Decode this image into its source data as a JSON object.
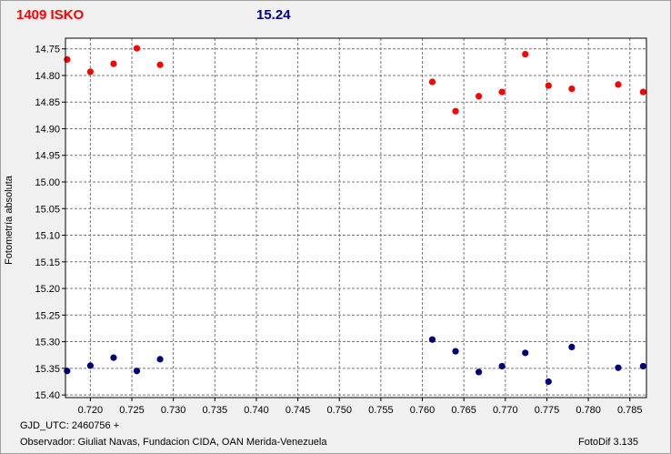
{
  "header": {
    "object_label": "1409 ISKO",
    "magnitude_label": "15.24"
  },
  "footer": {
    "gjd": "GJD_UTC: 2460756 +",
    "observer": "Observador: Giuliat Navas, Fundacion CIDA, OAN  Merida-Venezuela",
    "version": "FotoDif 3.135"
  },
  "colors": {
    "series_target": "#ff0000",
    "series_comparison": "#00007f",
    "title_left": "#ff0000",
    "title_right": "#00008b"
  },
  "chart_data": {
    "type": "scatter",
    "title": "",
    "xlabel": "",
    "ylabel": "Fotometría absoluta",
    "xlim": [
      0.717,
      0.787
    ],
    "ylim": [
      14.73,
      15.405
    ],
    "y_inverted": true,
    "grid": true,
    "x_ticks": [
      "0.720",
      "0.725",
      "0.730",
      "0.735",
      "0.740",
      "0.745",
      "0.750",
      "0.755",
      "0.760",
      "0.765",
      "0.770",
      "0.775",
      "0.780",
      "0.785"
    ],
    "y_ticks": [
      "14.75",
      "14.80",
      "14.85",
      "14.90",
      "14.95",
      "15.00",
      "15.05",
      "15.10",
      "15.15",
      "15.20",
      "15.25",
      "15.30",
      "15.35",
      "15.40"
    ],
    "series": [
      {
        "color": "#ff0000",
        "points": [
          [
            0.7172,
            14.77
          ],
          [
            0.72,
            14.793
          ],
          [
            0.7228,
            14.778
          ],
          [
            0.7256,
            14.749
          ],
          [
            0.7284,
            14.78
          ],
          [
            0.7612,
            14.812
          ],
          [
            0.764,
            14.867
          ],
          [
            0.7668,
            14.839
          ],
          [
            0.7696,
            14.831
          ],
          [
            0.7724,
            14.76
          ],
          [
            0.7752,
            14.819
          ],
          [
            0.778,
            14.825
          ],
          [
            0.7836,
            14.817
          ],
          [
            0.7866,
            14.831
          ]
        ]
      },
      {
        "color": "#00007f",
        "points": [
          [
            0.7172,
            15.355
          ],
          [
            0.72,
            15.345
          ],
          [
            0.7228,
            15.33
          ],
          [
            0.7256,
            15.355
          ],
          [
            0.7284,
            15.333
          ],
          [
            0.7612,
            15.296
          ],
          [
            0.764,
            15.318
          ],
          [
            0.7668,
            15.357
          ],
          [
            0.7696,
            15.346
          ],
          [
            0.7724,
            15.321
          ],
          [
            0.7752,
            15.375
          ],
          [
            0.778,
            15.31
          ],
          [
            0.7836,
            15.349
          ],
          [
            0.7866,
            15.346
          ]
        ]
      }
    ]
  }
}
